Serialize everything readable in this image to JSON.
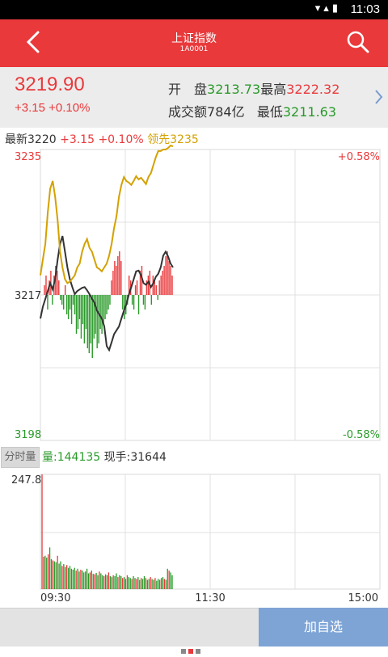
{
  "status": {
    "time": "11:03",
    "icons": "wifi signal battery"
  },
  "header": {
    "title": "上证指数",
    "code": "1A0001",
    "back_icon": "chevron-left-icon",
    "search_icon": "search-icon"
  },
  "quote": {
    "price": "3219.90",
    "change": "+3.15",
    "change_pct": "+0.10%",
    "open_label": "开　盘",
    "open_value": "3213.73",
    "high_label": "最高",
    "high_value": "3222.32",
    "amount_label": "成交额",
    "amount_value": "784",
    "amount_unit": "亿",
    "low_label": "最低",
    "low_value": "3211.63"
  },
  "info": {
    "latest_label": "最新",
    "latest_value": "3220",
    "change": "+3.15",
    "change_pct": "+0.10%",
    "lead_label": "领先",
    "lead_value": "3235"
  },
  "volume_info": {
    "tab_label": "分时量",
    "vol_label": "量:",
    "vol_value": "144135",
    "hand_label": "现手:",
    "hand_value": "31644"
  },
  "bottom": {
    "add_label": "加自选"
  },
  "colors": {
    "up": "#e9393b",
    "down": "#2a9a2a",
    "lead": "#d4a100",
    "price": "#333333"
  },
  "chart_data": [
    {
      "type": "line",
      "title": "",
      "y_axis_left_ticks": [
        "3235",
        "3217",
        "3198"
      ],
      "y_axis_right_ticks": [
        "+0.58%",
        "-0.58%"
      ],
      "ylim": [
        3198,
        3235
      ],
      "reference": 3217,
      "series": [
        {
          "role": "price",
          "color": "#333333",
          "values": [
            3213.5,
            3215,
            3216,
            3217,
            3218,
            3217.2,
            3218.5,
            3221,
            3223,
            3224,
            3222,
            3220,
            3218.5,
            3217.5,
            3216.6,
            3217,
            3217.2,
            3217.4,
            3217.5,
            3217.1,
            3216.6,
            3216,
            3215.5,
            3214.5,
            3214,
            3213.5,
            3212.5,
            3210,
            3209.5,
            3210.5,
            3211.5,
            3212,
            3212.5,
            3213.5,
            3214.5,
            3215.3,
            3216.5,
            3217.5,
            3218.5,
            3219.5,
            3219.6,
            3219,
            3218,
            3217.8,
            3218.2,
            3217.5,
            3218,
            3218.8,
            3219.2,
            3220,
            3221.5,
            3222,
            3221.4,
            3220.5,
            3220
          ]
        },
        {
          "role": "lead",
          "color": "#d4a100",
          "values": [
            3219,
            3221,
            3223,
            3227,
            3230,
            3231,
            3229,
            3226,
            3222,
            3220,
            3218.5,
            3218,
            3218.2,
            3218.6,
            3219,
            3220,
            3220.5,
            3222,
            3223,
            3223.6,
            3222.5,
            3222,
            3221,
            3220,
            3219.8,
            3219.5,
            3220,
            3220.5,
            3221.5,
            3223,
            3225,
            3226.5,
            3229,
            3230.5,
            3231.5,
            3231,
            3230.8,
            3230.5,
            3231,
            3231.6,
            3231.2,
            3231.4,
            3231,
            3230.6,
            3231.5,
            3232,
            3233,
            3234,
            3234.8,
            3234.8,
            3235,
            3235,
            3235.2,
            3235.5,
            3235.4
          ]
        },
        {
          "role": "tick-bars",
          "up_color": "#e9393b",
          "down_color": "#2a9a2a",
          "values": [
            2,
            4,
            -3,
            3,
            5,
            -2,
            4,
            6,
            5,
            3,
            -1,
            -2,
            -3,
            2,
            -4,
            -5,
            -3,
            -6,
            -2,
            -4,
            -8,
            -7,
            -5,
            -9,
            -6,
            -10,
            -7,
            -11,
            -12,
            -10,
            -13,
            -9,
            -8,
            -11,
            -10,
            -7,
            -8,
            -6,
            -5,
            -4,
            -3,
            -2,
            3,
            5,
            7,
            6,
            8,
            9,
            7,
            -3,
            -5,
            -4,
            -2,
            4,
            3,
            -2,
            -3,
            2,
            3,
            -4,
            5,
            6,
            -2,
            -3,
            3,
            4,
            5,
            -2,
            4,
            3,
            2,
            -1,
            3,
            4,
            5,
            6,
            8,
            9,
            7,
            6,
            4
          ]
        }
      ]
    },
    {
      "type": "bar",
      "title": "",
      "y_axis_max_label": "247.8",
      "x_axis_ticks": [
        "09:30",
        "11:30",
        "15:00"
      ],
      "ylim": [
        0,
        247.8
      ],
      "values": [
        247.8,
        70,
        72,
        68,
        75,
        90,
        65,
        62,
        60,
        58,
        72,
        55,
        60,
        50,
        54,
        48,
        52,
        46,
        50,
        44,
        42,
        46,
        40,
        44,
        38,
        42,
        40,
        36,
        38,
        44,
        34,
        36,
        40,
        33,
        32,
        35,
        30,
        38,
        34,
        30,
        28,
        32,
        30,
        36,
        28,
        26,
        30,
        28,
        34,
        26,
        30,
        28,
        24,
        26,
        22,
        30,
        26,
        24,
        22,
        28,
        24,
        22,
        26,
        20,
        24,
        22,
        28,
        24,
        20,
        22,
        26,
        22,
        20,
        24,
        18,
        22,
        20,
        24,
        26,
        22,
        20,
        44,
        40,
        36,
        30
      ]
    }
  ]
}
